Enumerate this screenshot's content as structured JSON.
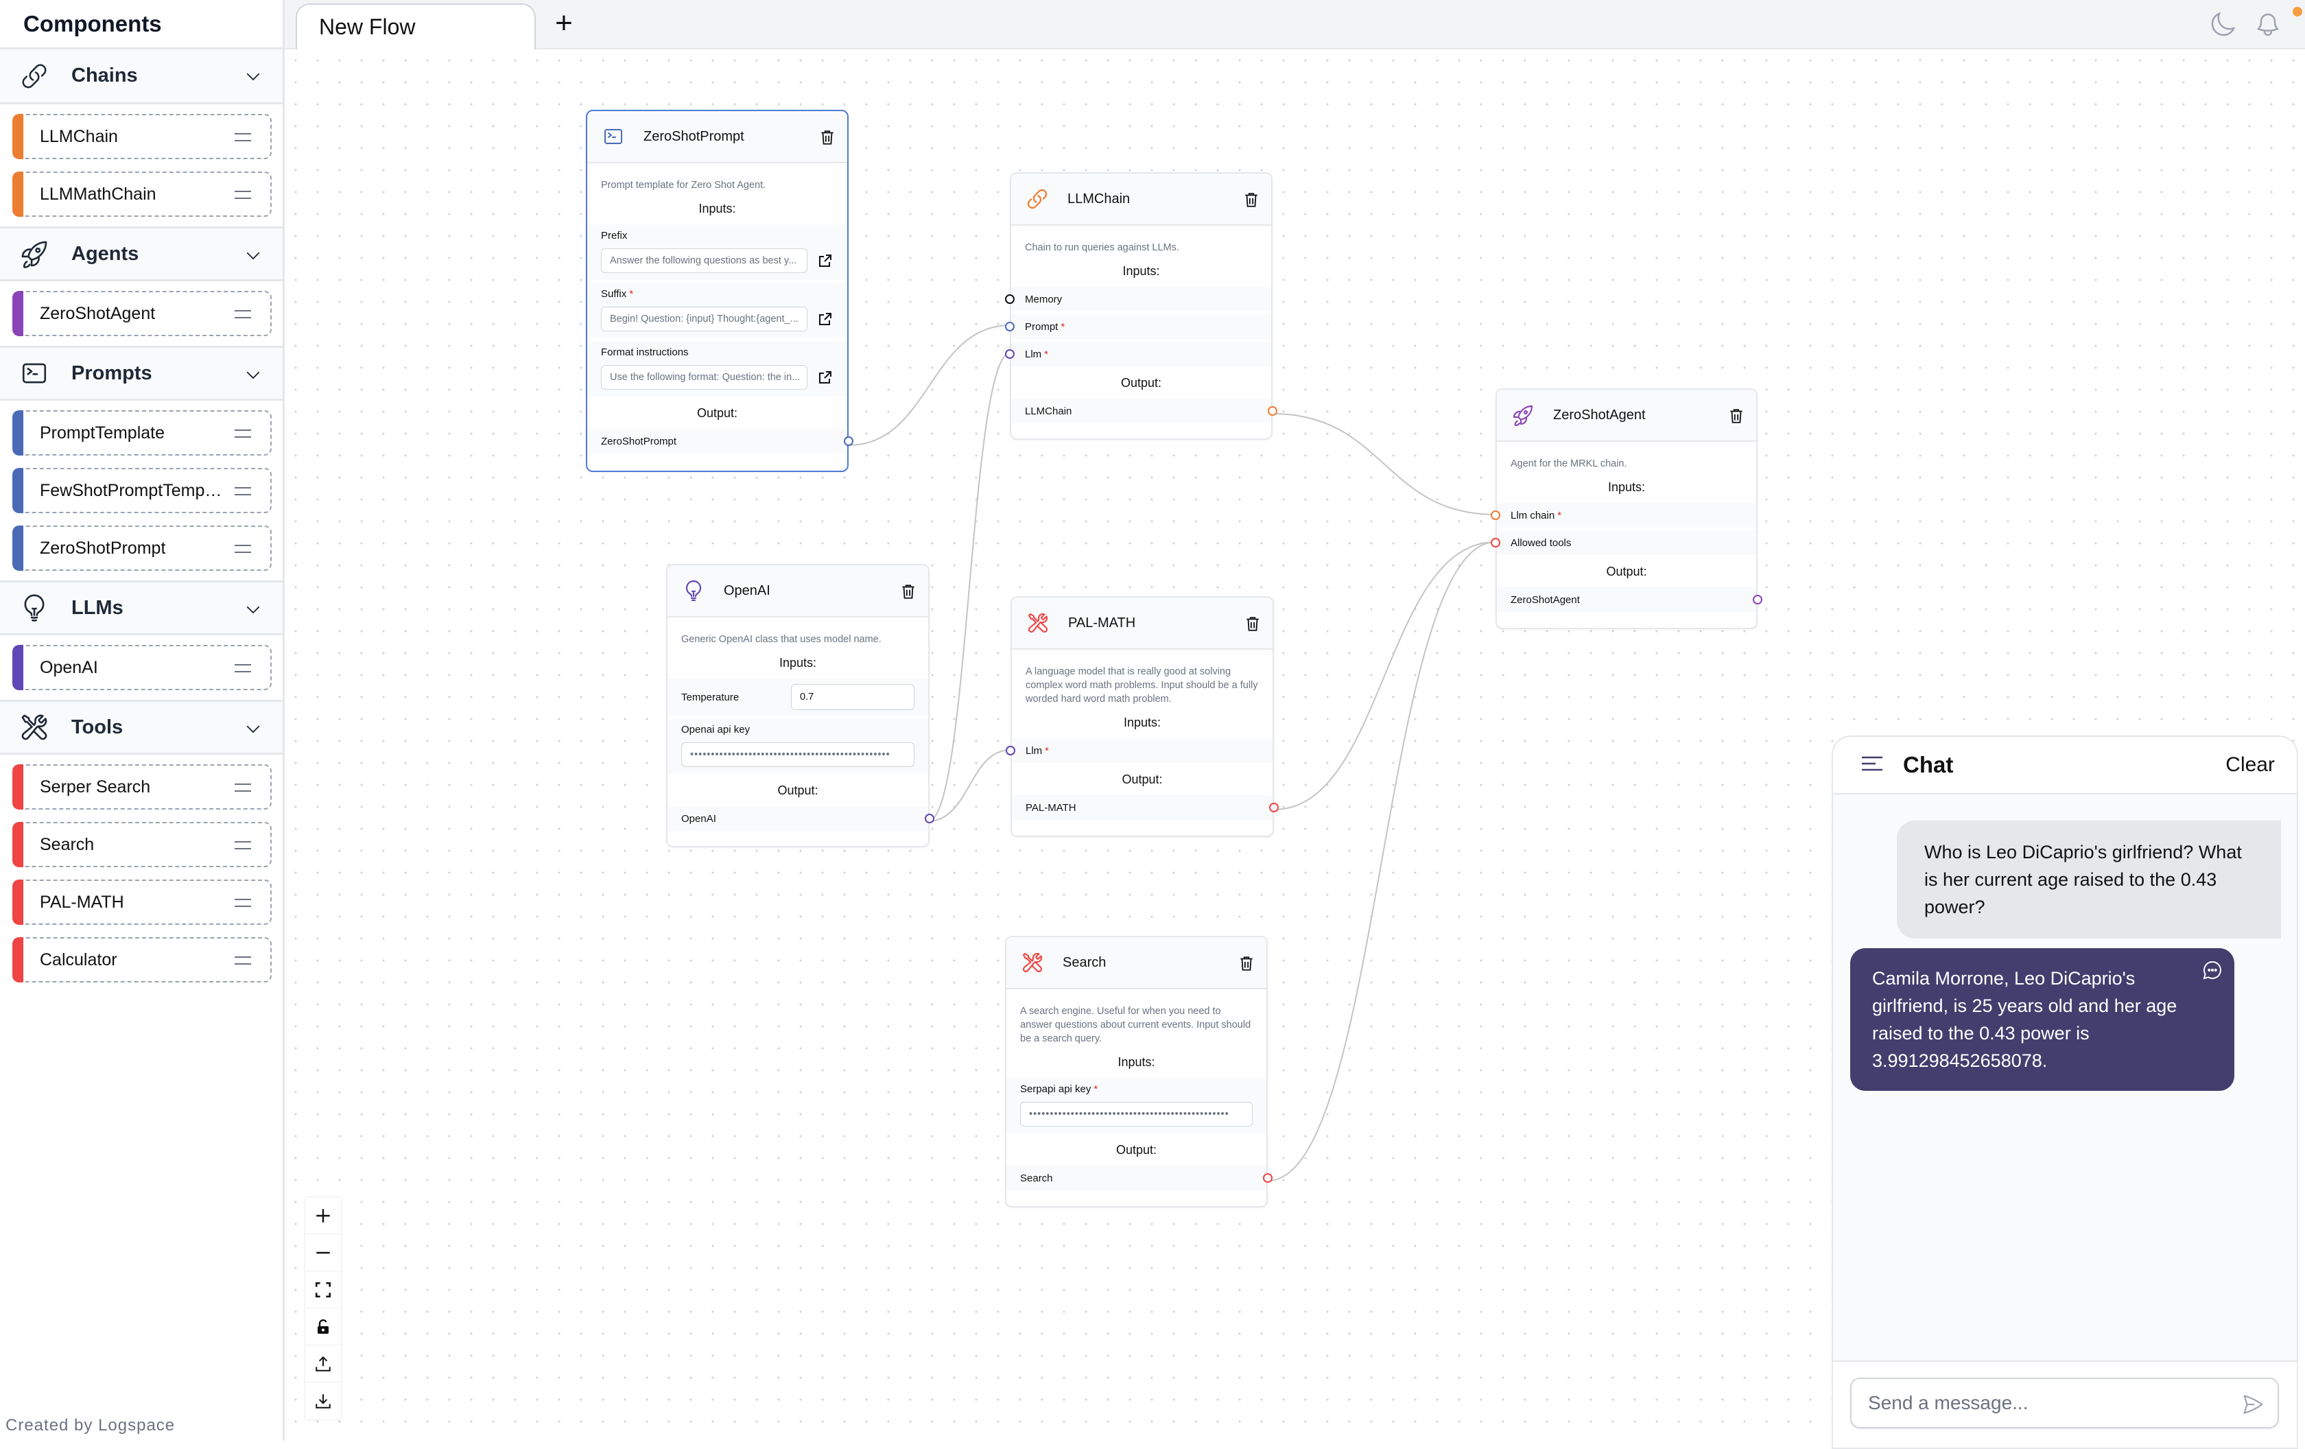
{
  "sidebar": {
    "title": "Components",
    "footer": "Created by Logspace",
    "categories": [
      {
        "label": "Chains",
        "icon": "link-icon",
        "items": [
          {
            "label": "LLMChain",
            "color": "#ed7d31"
          },
          {
            "label": "LLMMathChain",
            "color": "#ed7d31"
          }
        ]
      },
      {
        "label": "Agents",
        "icon": "rocket-icon",
        "items": [
          {
            "label": "ZeroShotAgent",
            "color": "#8b44b8"
          }
        ]
      },
      {
        "label": "Prompts",
        "icon": "terminal-icon",
        "items": [
          {
            "label": "PromptTemplate",
            "color": "#4a6ab8"
          },
          {
            "label": "FewShotPromptTemplate",
            "color": "#4a6ab8"
          },
          {
            "label": "ZeroShotPrompt",
            "color": "#4a6ab8"
          }
        ]
      },
      {
        "label": "LLMs",
        "icon": "lightbulb-icon",
        "items": [
          {
            "label": "OpenAI",
            "color": "#6146b5"
          }
        ]
      },
      {
        "label": "Tools",
        "icon": "wrench-screwdriver-icon",
        "items": [
          {
            "label": "Serper Search",
            "color": "#ef4444"
          },
          {
            "label": "Search",
            "color": "#ef4444"
          },
          {
            "label": "PAL-MATH",
            "color": "#ef4444"
          },
          {
            "label": "Calculator",
            "color": "#ef4444"
          }
        ]
      }
    ]
  },
  "topbar": {
    "tab_label": "New Flow",
    "add_tab": "+"
  },
  "nodes": {
    "zeroshotprompt": {
      "title": "ZeroShotPrompt",
      "description": "Prompt template for Zero Shot Agent.",
      "inputs_label": "Inputs:",
      "output_label": "Output:",
      "fields": [
        {
          "label": "Prefix",
          "required": false,
          "value": "Answer the following questions as best y..."
        },
        {
          "label": "Suffix",
          "required": true,
          "value": "Begin! Question: {input} Thought:{agent_..."
        },
        {
          "label": "Format instructions",
          "required": false,
          "value": "Use the following format: Question: the in..."
        }
      ],
      "output": "ZeroShotPrompt",
      "color": "#4a6ab8"
    },
    "llmchain": {
      "title": "LLMChain",
      "description": "Chain to run queries against LLMs.",
      "inputs_label": "Inputs:",
      "output_label": "Output:",
      "inputs": [
        {
          "label": "Memory",
          "required": false
        },
        {
          "label": "Prompt",
          "required": true
        },
        {
          "label": "Llm",
          "required": true
        }
      ],
      "output": "LLMChain",
      "color": "#ed7d31"
    },
    "zeroshotagent": {
      "title": "ZeroShotAgent",
      "description": "Agent for the MRKL chain.",
      "inputs_label": "Inputs:",
      "output_label": "Output:",
      "inputs": [
        {
          "label": "Llm chain",
          "required": true
        },
        {
          "label": "Allowed tools",
          "required": false
        }
      ],
      "output": "ZeroShotAgent",
      "color": "#8b44b8"
    },
    "openai": {
      "title": "OpenAI",
      "description": "Generic OpenAI class that uses model name.",
      "inputs_label": "Inputs:",
      "output_label": "Output:",
      "temperature_label": "Temperature",
      "temperature_value": "0.7",
      "api_key_label": "Openai api key",
      "api_key_value": "••••••••••••••••••••••••••••••••••••••••••••••••",
      "output": "OpenAI",
      "color": "#6146b5"
    },
    "palmath": {
      "title": "PAL-MATH",
      "description": "A language model that is really good at solving complex word math problems. Input should be a fully worded hard word math problem.",
      "inputs_label": "Inputs:",
      "output_label": "Output:",
      "inputs": [
        {
          "label": "Llm",
          "required": true
        }
      ],
      "output": "PAL-MATH",
      "color": "#ef4444"
    },
    "search": {
      "title": "Search",
      "description": "A search engine. Useful for when you need to answer questions about current events. Input should be a search query.",
      "inputs_label": "Inputs:",
      "output_label": "Output:",
      "api_key_label": "Serpapi api key",
      "api_key_required": true,
      "api_key_value": "••••••••••••••••••••••••••••••••••••••••••••••••",
      "output": "Search",
      "color": "#ef4444"
    }
  },
  "chat": {
    "title": "Chat",
    "clear_label": "Clear",
    "messages": [
      {
        "role": "user",
        "text": "Who is Leo DiCaprio's girlfriend? What is her current age raised to the 0.43 power?"
      },
      {
        "role": "bot",
        "text": "Camila Morrone, Leo DiCaprio's girlfriend, is 25 years old and her age raised to the 0.43 power is 3.991298452658078."
      }
    ],
    "input_placeholder": "Send a message..."
  },
  "required_marker": "*",
  "colors": {
    "edge": "#c4c4c4",
    "selected_border": "#4f7bd6",
    "bot_bubble": "#433e6e",
    "notification_dot": "#f59e42"
  }
}
